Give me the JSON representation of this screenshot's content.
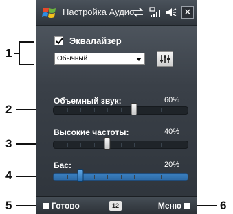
{
  "titlebar": {
    "title": "Настройка Аудио",
    "close_label": "✕",
    "icons": [
      "windows-logo-icon",
      "connectivity-icon",
      "signal-icon",
      "volume-icon",
      "close-icon"
    ]
  },
  "equalizer": {
    "checkbox_label": "Эквалайзер",
    "checked": true,
    "preset_value": "Обычный"
  },
  "sliders": [
    {
      "label": "Объемный звук:",
      "value_text": "60%",
      "value": 0.6
    },
    {
      "label": "Высокие частоты:",
      "value_text": "40%",
      "value": 0.4
    },
    {
      "label": "Бас:",
      "value_text": "20%",
      "value": 0.2
    }
  ],
  "softbar": {
    "left_label": "Готово",
    "right_label": "Меню",
    "input_icon_label": "12"
  },
  "callouts": [
    "1",
    "2",
    "3",
    "4",
    "5",
    "6"
  ]
}
